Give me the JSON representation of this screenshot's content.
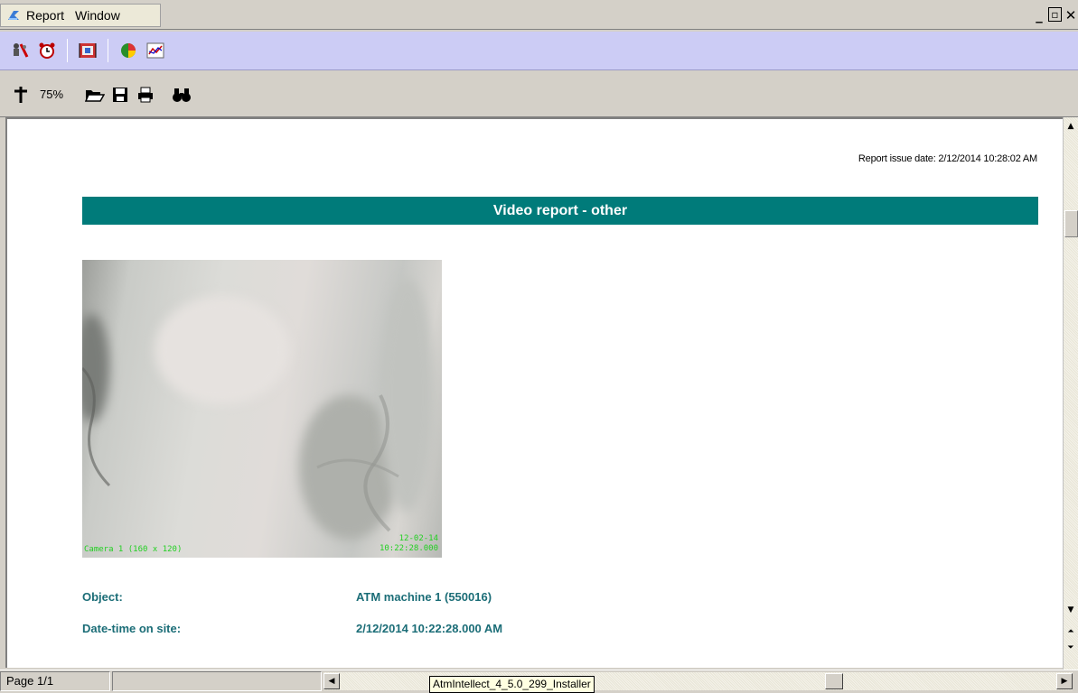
{
  "menu": {
    "items": [
      "Report",
      "Window"
    ],
    "window_controls": {
      "minimize": "_",
      "restore": "▫",
      "close": "✕"
    }
  },
  "toolbar2": {
    "zoom": "75%"
  },
  "report": {
    "issue_date": "Report issue date: 2/12/2014 10:28:02 AM",
    "title": "Video report - other",
    "camera_overlay_label": "Camera 1 (160 x 120)",
    "camera_overlay_date": "12-02-14",
    "camera_overlay_time": "10:22:28.000",
    "fields": [
      {
        "label": "Object:",
        "value": "ATM machine 1 (550016)"
      },
      {
        "label": "Date-time on site:",
        "value": "2/12/2014 10:22:28.000 AM"
      }
    ]
  },
  "status": {
    "page": "Page 1/1",
    "tooltip": "AtmIntellect_4_5.0_299_Installer"
  },
  "colors": {
    "title_bar": "#007b7a",
    "field_text": "#1b6d77",
    "toolbar_bg": "#ccccf5",
    "camera_overlay": "#22d022"
  },
  "icons": {
    "toolbar1": [
      "objects-icon",
      "alarm-clock-icon",
      "film-icon",
      "pie-chart-icon",
      "line-chart-icon"
    ],
    "toolbar2": [
      "zoom-icon",
      "open-folder-icon",
      "save-icon",
      "print-icon",
      "binoculars-icon"
    ]
  }
}
